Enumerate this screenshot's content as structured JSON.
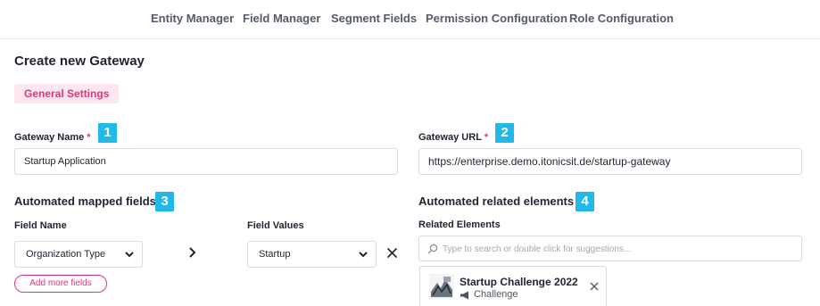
{
  "nav": {
    "tabs": [
      "Entity Manager",
      "Field Manager",
      "Segment Fields",
      "Permission Configuration",
      "Role Configuration"
    ]
  },
  "page": {
    "title": "Create new Gateway",
    "section_tab": "General Settings"
  },
  "badges": [
    "1",
    "2",
    "3",
    "4"
  ],
  "form": {
    "gateway_name": {
      "label": "Gateway Name",
      "required_mark": "*",
      "value": "Startup Application"
    },
    "gateway_url": {
      "label": "Gateway URL",
      "required_mark": "*",
      "value": "https://enterprise.demo.itonicsit.de/startup-gateway"
    }
  },
  "mapped_fields": {
    "heading": "Automated mapped fields",
    "field_name_label": "Field Name",
    "field_values_label": "Field Values",
    "field_name_value": "Organization Type",
    "field_value_value": "Startup",
    "add_button": "Add more fields"
  },
  "related": {
    "heading": "Automated related elements",
    "label": "Related Elements",
    "search_placeholder": "Type to search or double click for suggestions...",
    "element": {
      "title": "Startup Challenge 2022",
      "type": "Challenge"
    }
  },
  "colors": {
    "accent": "#e0337f",
    "accent_bg": "#fde7ef",
    "badge": "#22b8e8"
  }
}
